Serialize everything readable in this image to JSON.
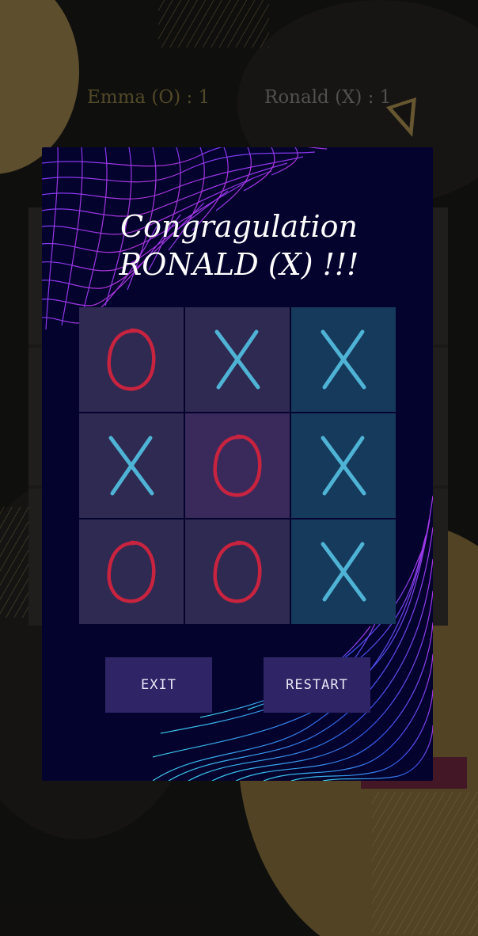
{
  "scores": {
    "player_o": "Emma (O) : 1",
    "player_x": "Ronald (X) : 1"
  },
  "dialog": {
    "title_line1": "Congragulation",
    "title_line2": "RONALD (X) !!!",
    "exit_label": "EXIT",
    "restart_label": "RESTART"
  },
  "board": {
    "cells": [
      "O",
      "X",
      "X",
      "X",
      "O",
      "X",
      "O",
      "O",
      "X"
    ],
    "winning_cells": [
      2,
      5,
      8
    ]
  },
  "colors": {
    "o_mark": "#c8233f",
    "x_mark": "#4fb3d6",
    "dialog_bg": "#04032e",
    "button_bg": "#2e2466"
  }
}
